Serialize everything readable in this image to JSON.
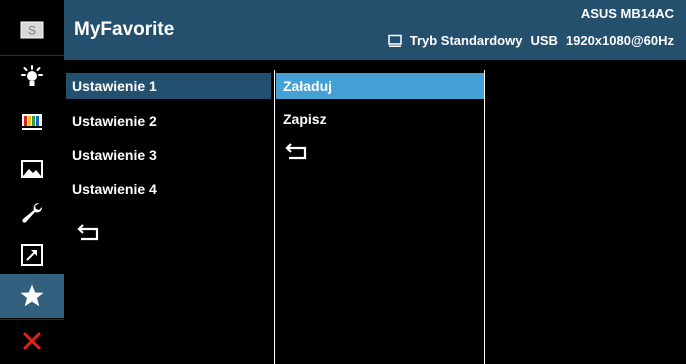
{
  "header": {
    "title": "MyFavorite",
    "model": "ASUS MB14AC",
    "mode": "Tryb Standardowy",
    "input": "USB",
    "resolution": "1920x1080@60Hz"
  },
  "sidebar": {
    "items": [
      {
        "icon": "splendid-icon",
        "active": false
      },
      {
        "icon": "blue-light-filter-icon",
        "active": false
      },
      {
        "icon": "color-icon",
        "active": false
      },
      {
        "icon": "image-icon",
        "active": false
      },
      {
        "icon": "system-setup-icon",
        "active": false
      },
      {
        "icon": "shortcut-icon",
        "active": false
      },
      {
        "icon": "star-icon",
        "active": true
      },
      {
        "icon": "close-icon",
        "active": false
      }
    ]
  },
  "menu": {
    "items": [
      "Ustawienie 1",
      "Ustawienie 2",
      "Ustawienie 3",
      "Ustawienie 4"
    ],
    "selected": "Ustawienie 1"
  },
  "submenu": {
    "items": [
      "Załaduj",
      "Zapisz"
    ],
    "selected": "Załaduj"
  },
  "colors": {
    "header_bg": "#24506e",
    "selection_dark": "#23506e",
    "selection_light": "#45a0d6",
    "close_red": "#e2231a"
  }
}
